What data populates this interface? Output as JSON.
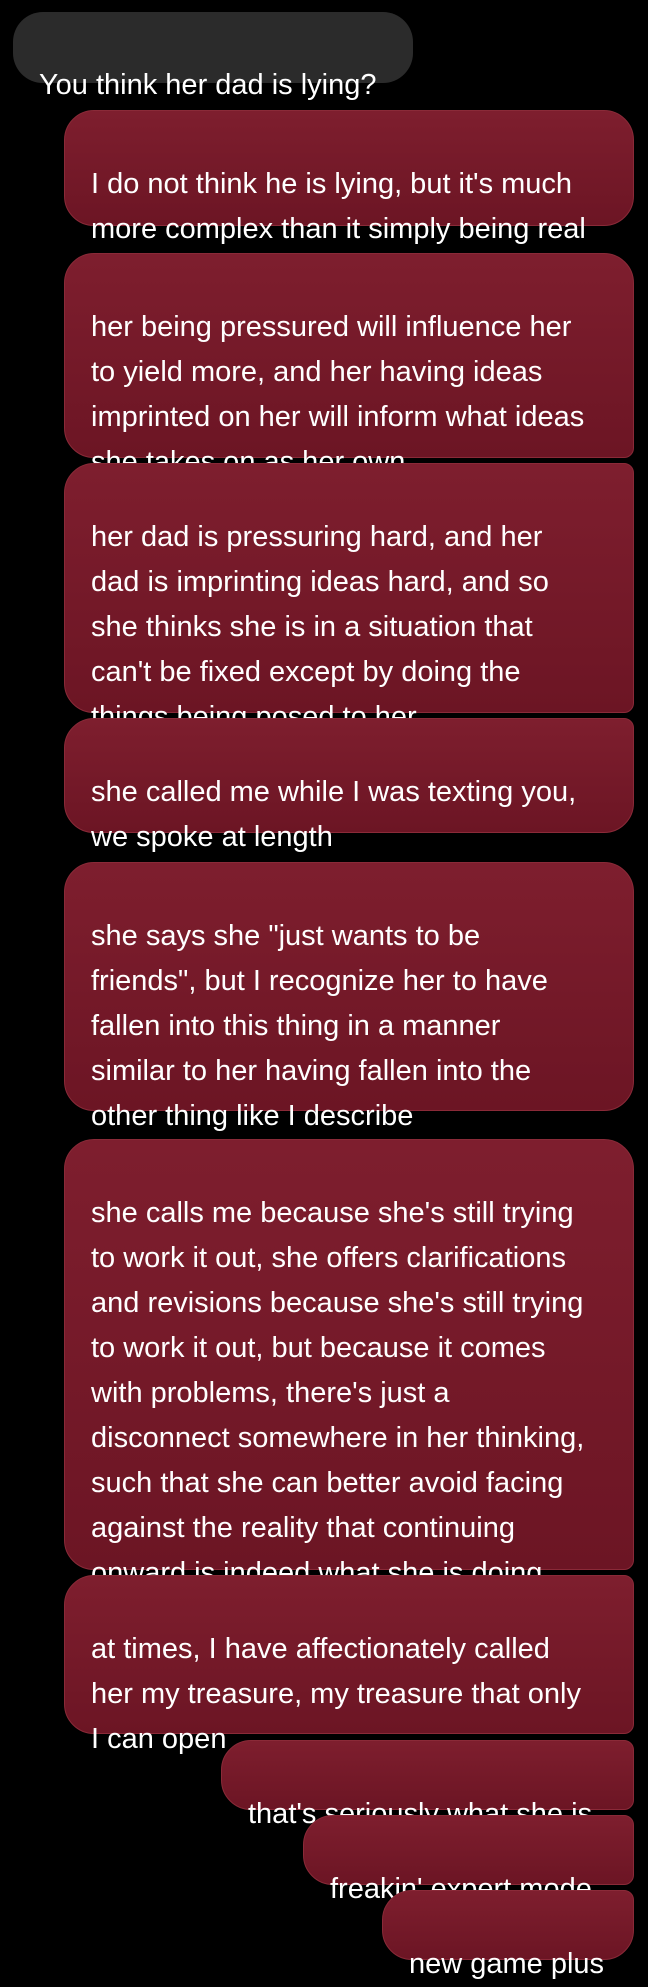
{
  "conversation": {
    "messages": [
      {
        "sender": "other",
        "text": "You think her dad is lying?"
      },
      {
        "sender": "me",
        "text": "I do not think he is lying, but it's much\nmore complex than it simply being real"
      },
      {
        "sender": "me",
        "text": "her being pressured will influence her\nto yield more, and her having ideas\nimprinted on her will inform what ideas\nshe takes on as her own"
      },
      {
        "sender": "me",
        "text": "her dad is pressuring hard, and her\ndad is imprinting ideas hard, and so\nshe thinks she is in a situation that\ncan't be fixed except by doing the\nthings being posed to her"
      },
      {
        "sender": "me",
        "text": "she called me while I was texting you,\nwe spoke at length"
      },
      {
        "sender": "me",
        "text": "she says she \"just wants to be\nfriends\", but I recognize her to have\nfallen into this thing in a manner\nsimilar to her having fallen into the\nother thing like I describe"
      },
      {
        "sender": "me",
        "text": "she calls me because she's still trying\nto work it out, she offers clarifications\nand revisions because she's still trying\nto work it out, but because it comes\nwith problems, there's just a\ndisconnect somewhere in her thinking,\nsuch that she can better avoid facing\nagainst the reality that continuing\nonward is indeed what she is doing"
      },
      {
        "sender": "me",
        "text": "at times, I have affectionately called\nher my treasure, my treasure that only\nI can open"
      },
      {
        "sender": "me",
        "text": "that's seriously what she is"
      },
      {
        "sender": "me",
        "text": "freakin' expert mode"
      },
      {
        "sender": "me",
        "text": "new game plus"
      }
    ]
  },
  "colors": {
    "background": "#000000",
    "incoming_bubble": "#2b2b2b",
    "outgoing_bubble": "#751a29",
    "text": "#ffffff"
  }
}
